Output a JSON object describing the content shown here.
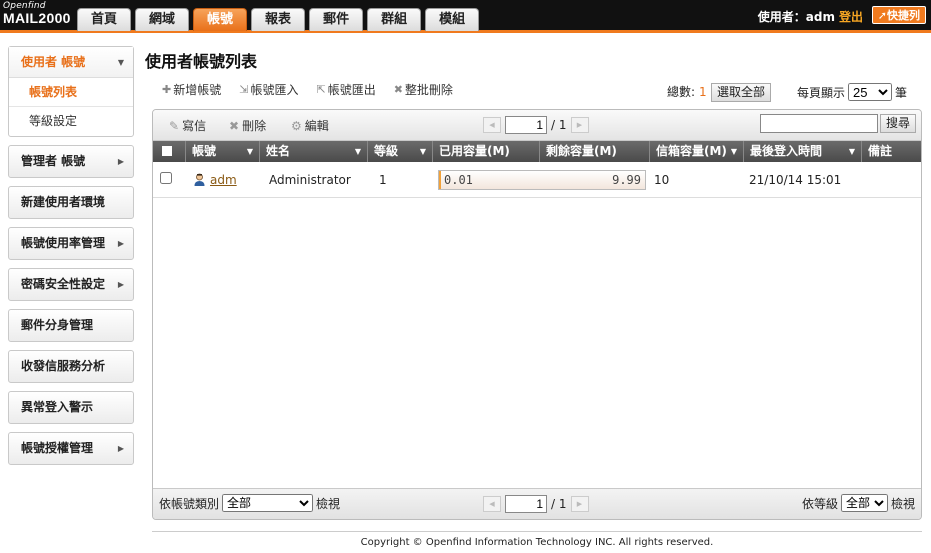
{
  "logo": {
    "line1": "Openfind",
    "line2": "MAIL2000"
  },
  "nav": {
    "tabs": [
      "首頁",
      "網域",
      "帳號",
      "報表",
      "郵件",
      "群組",
      "模組"
    ],
    "active": "帳號"
  },
  "user": {
    "label": "使用者：adm",
    "logout": "登出",
    "quicklink": "快捷列"
  },
  "sidebar": {
    "open_group": {
      "label": "使用者 帳號",
      "items": [
        "帳號列表",
        "等級設定"
      ]
    },
    "groups": [
      {
        "label": "管理者 帳號",
        "arrow": "▶"
      },
      {
        "label": "新建使用者環境",
        "arrow": ""
      },
      {
        "label": "帳號使用率管理",
        "arrow": "▶"
      },
      {
        "label": "密碼安全性設定",
        "arrow": "▶"
      },
      {
        "label": "郵件分身管理",
        "arrow": ""
      },
      {
        "label": "收發信服務分析",
        "arrow": ""
      },
      {
        "label": "異常登入警示",
        "arrow": ""
      },
      {
        "label": "帳號授權管理",
        "arrow": "▶"
      }
    ]
  },
  "page": {
    "title": "使用者帳號列表"
  },
  "actions": {
    "add": "新增帳號",
    "import": "帳號匯入",
    "export": "帳號匯出",
    "batch_delete": "整批刪除"
  },
  "summary": {
    "total_label": "總數:",
    "total": "1",
    "select_all": "選取全部",
    "per_page_label": "每頁顯示",
    "per_page": "25",
    "per_page_unit": "筆"
  },
  "toolbar": {
    "write": "寫信",
    "delete": "刪除",
    "edit": "編輯",
    "page": "1",
    "page_total": "/ 1",
    "search_button": "搜尋",
    "search_value": ""
  },
  "table": {
    "columns": [
      "帳號",
      "姓名",
      "等級",
      "已用容量(M)",
      "剩餘容量(M)",
      "信箱容量(M)",
      "最後登入時間",
      "備註"
    ],
    "rows": [
      {
        "account": "adm",
        "name": "Administrator",
        "level": "1",
        "used": "0.01",
        "remaining": "9.99",
        "quota": "10",
        "last_login": "21/10/14 15:01",
        "note": "",
        "usage_fraction": 0.001
      }
    ]
  },
  "footer": {
    "type_filter_label": "依帳號類別",
    "type_filter_value": "全部",
    "view": "檢視",
    "page": "1",
    "page_total": "/ 1",
    "level_filter_label": "依等級",
    "level_filter_value": "全部"
  },
  "copyright": "Copyright © Openfind Information Technology INC. All rights reserved."
}
